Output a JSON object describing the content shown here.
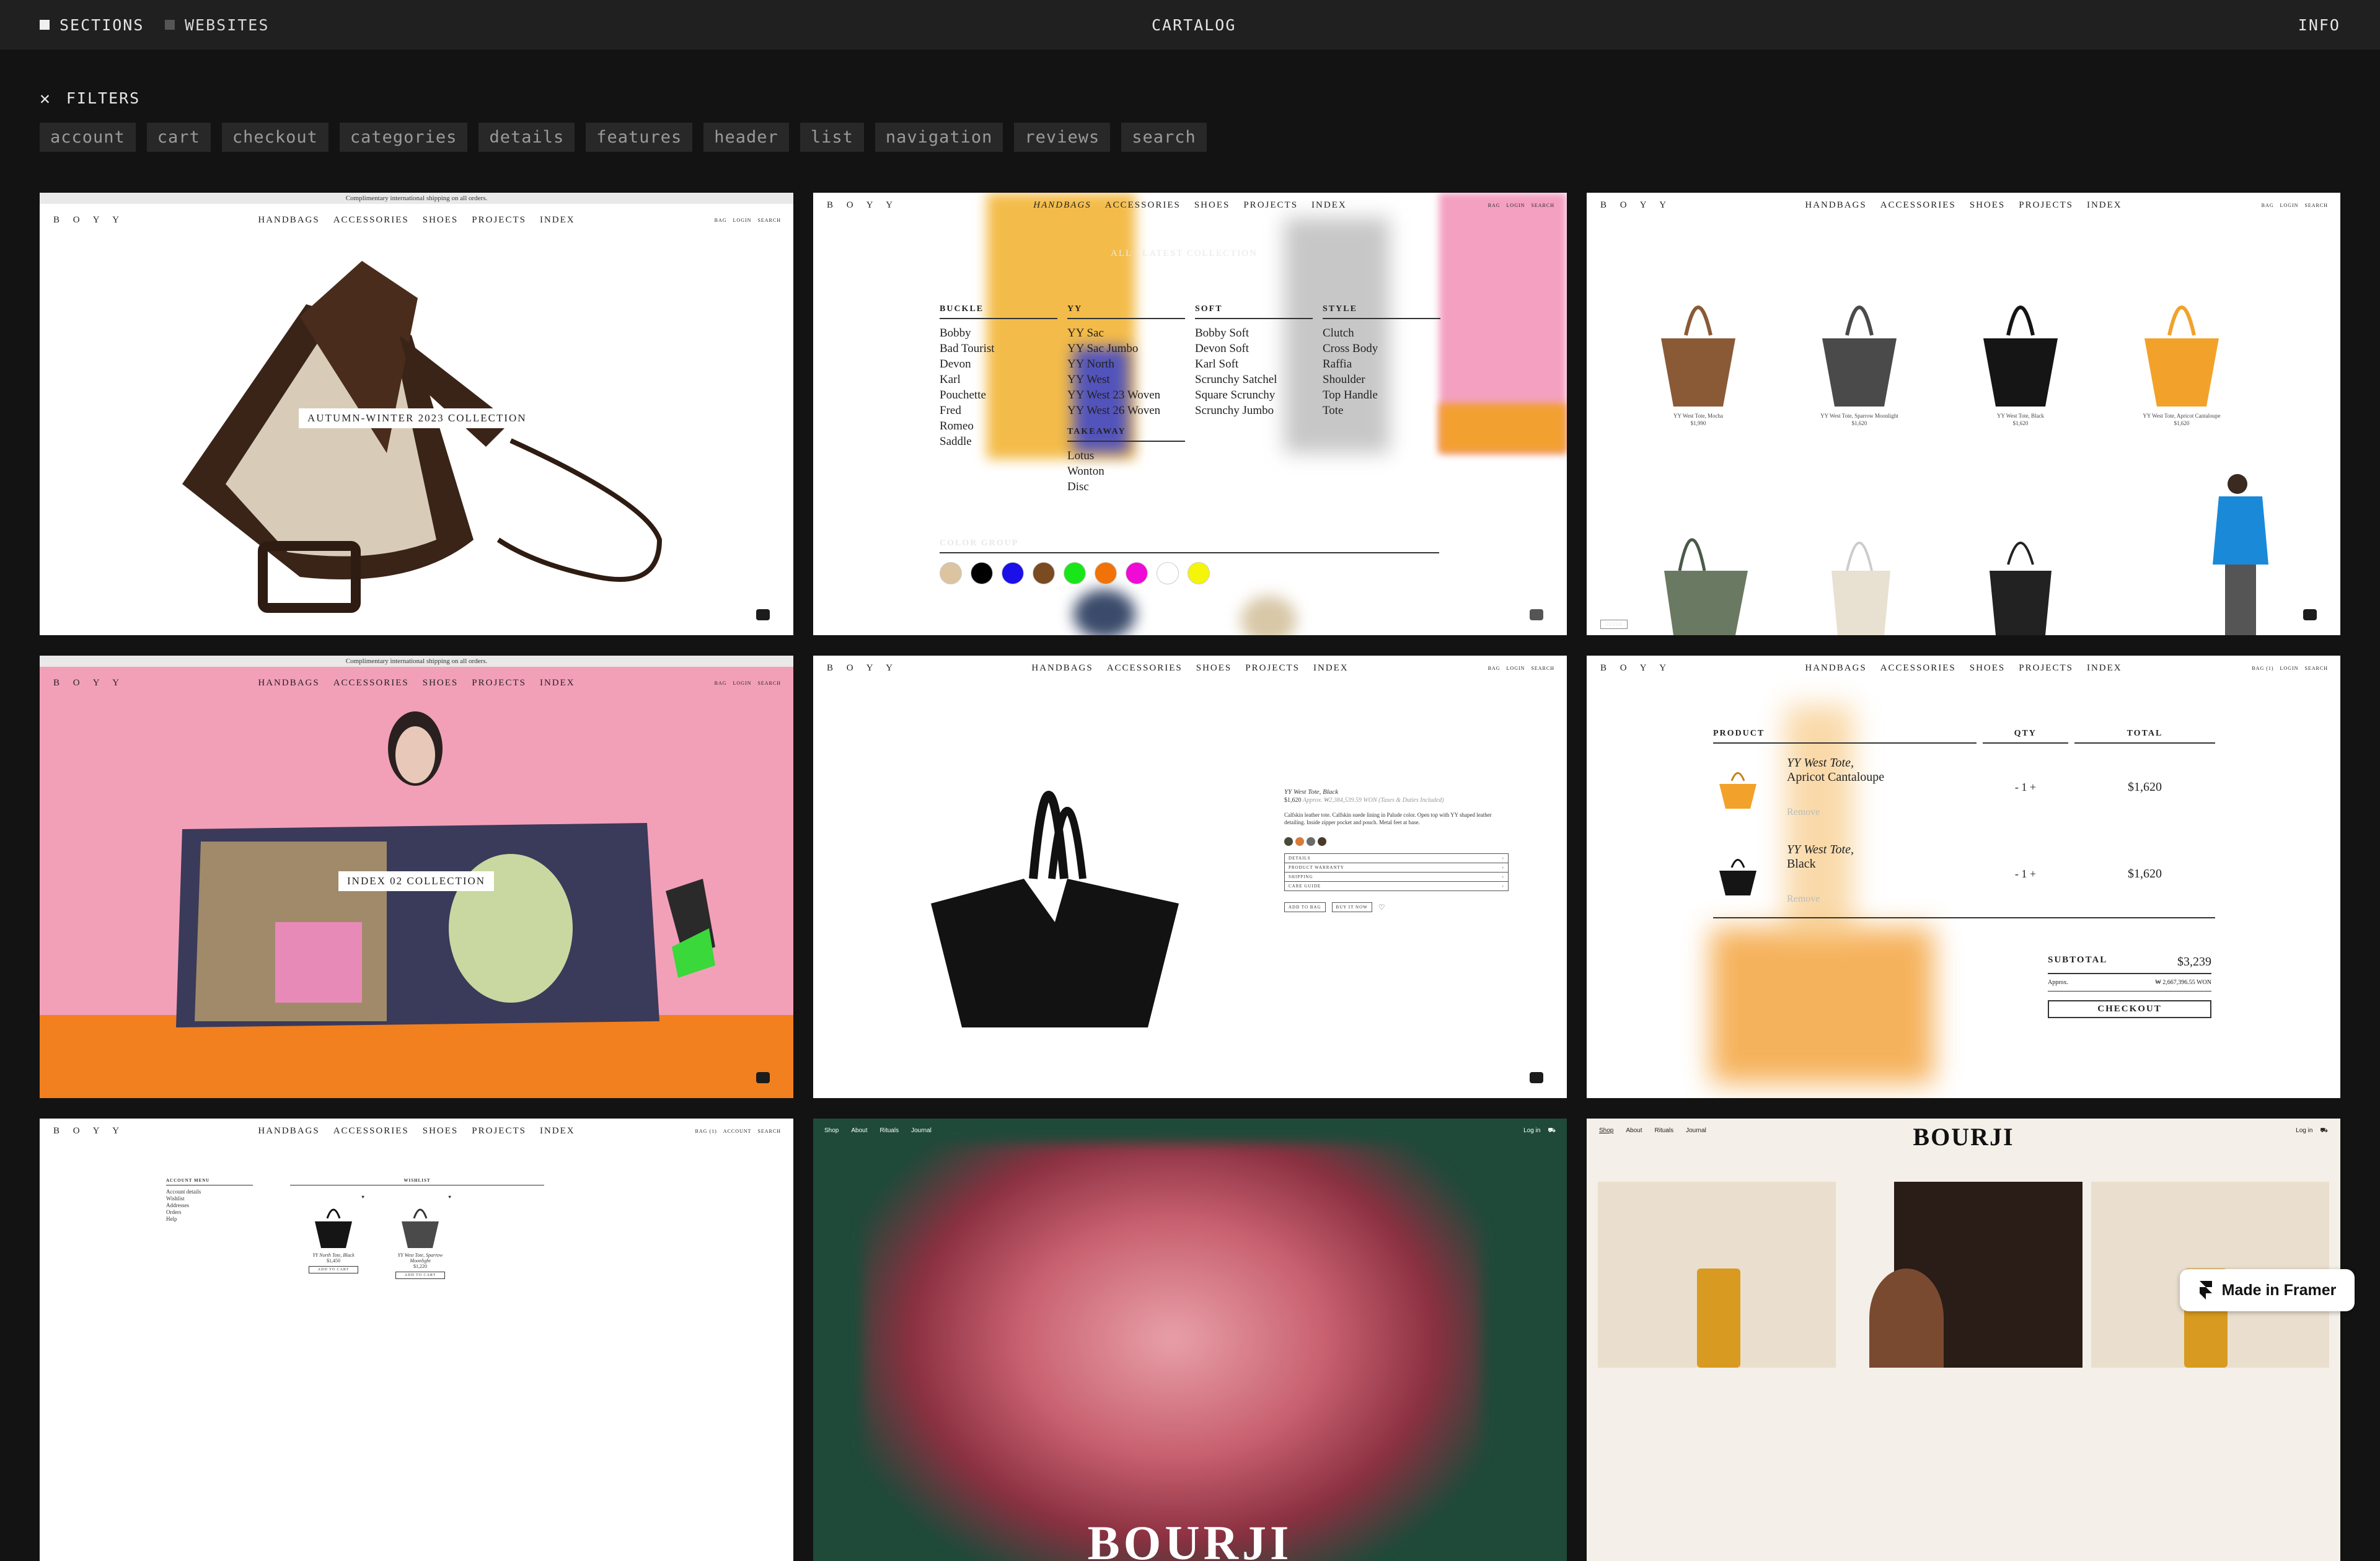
{
  "topbar": {
    "sections": "SECTIONS",
    "websites": "WEBSITES",
    "title": "CARTALOG",
    "info": "INFO"
  },
  "filters": {
    "label": "FILTERS",
    "chips": [
      "account",
      "cart",
      "checkout",
      "categories",
      "details",
      "features",
      "header",
      "list",
      "navigation",
      "reviews",
      "search"
    ]
  },
  "boyy": {
    "logo": "B O Y Y",
    "links": [
      "HANDBAGS",
      "ACCESSORIES",
      "SHOES",
      "PROJECTS",
      "INDEX"
    ],
    "util": [
      "BAG",
      "LOGIN",
      "SEARCH"
    ],
    "util_account": [
      "BAG (1)",
      "ACCOUNT",
      "SEARCH"
    ],
    "shipping": "Complimentary international shipping on all orders."
  },
  "card1": {
    "caption": "AUTUMN-WINTER 2023 COLLECTION"
  },
  "card2": {
    "tabs": [
      "ALL",
      "LATEST COLLECTION"
    ],
    "columns": [
      {
        "head": "BUCKLE",
        "items": [
          "Bobby",
          "Bad Tourist",
          "Devon",
          "Karl",
          "Pouchette",
          "Fred",
          "Romeo",
          "Saddle"
        ]
      },
      {
        "head": "YY",
        "items": [
          "YY Sac",
          "YY Sac Jumbo",
          "YY North",
          "YY West",
          "YY West 23 Woven",
          "YY West 26 Woven"
        ]
      },
      {
        "head": "SOFT",
        "items": [
          "Bobby Soft",
          "Devon Soft",
          "Karl Soft",
          "Scrunchy Satchel",
          "Square Scrunchy",
          "Scrunchy Jumbo"
        ]
      },
      {
        "head": "STYLE",
        "items": [
          "Clutch",
          "Cross Body",
          "Raffia",
          "Shoulder",
          "Top Handle",
          "Tote"
        ]
      }
    ],
    "takeaway": {
      "head": "TAKEAWAY",
      "items": [
        "Lotus",
        "Wonton",
        "Disc"
      ]
    },
    "color_group": "COLOR GROUP",
    "swatches": [
      "#dcc4a0",
      "#000000",
      "#1b10e8",
      "#7a4a21",
      "#19e619",
      "#f2720a",
      "#f00ad6",
      "#ffffff",
      "#f5f50a"
    ]
  },
  "card3": {
    "products": [
      {
        "name": "YY West Tote, Mocha",
        "price": "$1,990",
        "color": "#8a5a36"
      },
      {
        "name": "YY West Tote, Sparrow Moonlight",
        "price": "$1,620",
        "color": "#4a4a4a"
      },
      {
        "name": "YY West Tote, Black",
        "price": "$1,620",
        "color": "#151515"
      },
      {
        "name": "YY West Tote, Apricot Cantaloupe",
        "price": "$1,620",
        "color": "#f2a22a"
      }
    ],
    "filter": "FILTER"
  },
  "card4": {
    "caption": "INDEX 02 COLLECTION"
  },
  "card5": {
    "title": "YY West Tote, Black",
    "price": "$1,620",
    "approx": "Approx. ₩2,384,539.59 WON (Taxes & Duties Included)",
    "description": "Calfskin leather tote. Calfskin suede lining in Palude color. Open top with YY shaped leather detailing. Inside zipper pocket and pouch. Metal feet at base.",
    "accordion": [
      "DETAILS",
      "PRODUCT WARRANTY",
      "SHIPPING",
      "CARE GUIDE"
    ],
    "add_to_bag": "ADD TO BAG",
    "buy_now": "BUY IT NOW",
    "swatches": [
      "#4a4a3a",
      "#d97a3a",
      "#6a6a6a",
      "#4a3a2a"
    ]
  },
  "card6": {
    "headers": [
      "PRODUCT",
      "QTY",
      "TOTAL"
    ],
    "items": [
      {
        "name": "YY West Tote,",
        "variant": "Apricot Cantaloupe",
        "qty": "1",
        "total": "$1,620",
        "remove": "Remove"
      },
      {
        "name": "YY West Tote,",
        "variant": "Black",
        "qty": "1",
        "total": "$1,620",
        "remove": "Remove"
      }
    ],
    "subtotal_label": "SUBTOTAL",
    "subtotal": "$3,239",
    "approx_label": "Approx.",
    "approx_value": "₩ 2,667,396.55 WON",
    "checkout": "CHECKOUT"
  },
  "card7": {
    "menu_head": "ACCOUNT MENU",
    "menu": [
      "Account details",
      "Wishlist",
      "Addresses",
      "Orders",
      "Help"
    ],
    "wishlist_head": "WISHLIST",
    "items": [
      {
        "name": "YY North Tote, Black",
        "price": "$1,450",
        "btn": "ADD TO CART"
      },
      {
        "name": "YY West Tote, Sparrow Moonlight",
        "price": "$1,220",
        "btn": "ADD TO CART"
      }
    ]
  },
  "card8": {
    "nav": [
      "Shop",
      "About",
      "Rituals",
      "Journal"
    ],
    "login": "Log in",
    "brand": "BOURJI"
  },
  "card9": {
    "nav": [
      "Shop",
      "About",
      "Rituals",
      "Journal"
    ],
    "login": "Log in",
    "brand": "BOURJI"
  },
  "framer": {
    "label": "Made in Framer"
  }
}
